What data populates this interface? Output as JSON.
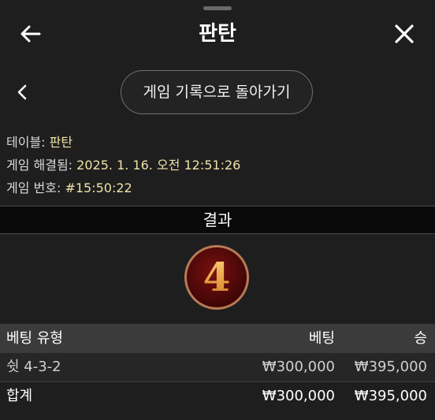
{
  "header": {
    "title": "판탄",
    "back_icon": "arrow-left-icon",
    "close_icon": "close-icon"
  },
  "nav": {
    "chevron_icon": "chevron-left-icon",
    "history_button_label": "게임 기록으로 돌아가기"
  },
  "info": {
    "table_label": "테이블:",
    "table_value": "판탄",
    "resolved_label": "게임 해결됨:",
    "resolved_value": "2025. 1. 16. 오전 12:51:26",
    "game_no_label": "게임 번호:",
    "game_no_value": "#15:50:22"
  },
  "result": {
    "header": "결과",
    "number": "4",
    "colors": {
      "ball_fill": "#5a0a0a",
      "ball_ring": "#c98a5a",
      "digit": "#f2a93b"
    }
  },
  "bets_table": {
    "columns": [
      "베팅 유형",
      "베팅",
      "승"
    ],
    "rows": [
      {
        "type": "쉿 4-3-2",
        "bet": "₩300,000",
        "win": "₩395,000"
      }
    ],
    "total": {
      "label": "합계",
      "bet": "₩300,000",
      "win": "₩395,000"
    }
  }
}
